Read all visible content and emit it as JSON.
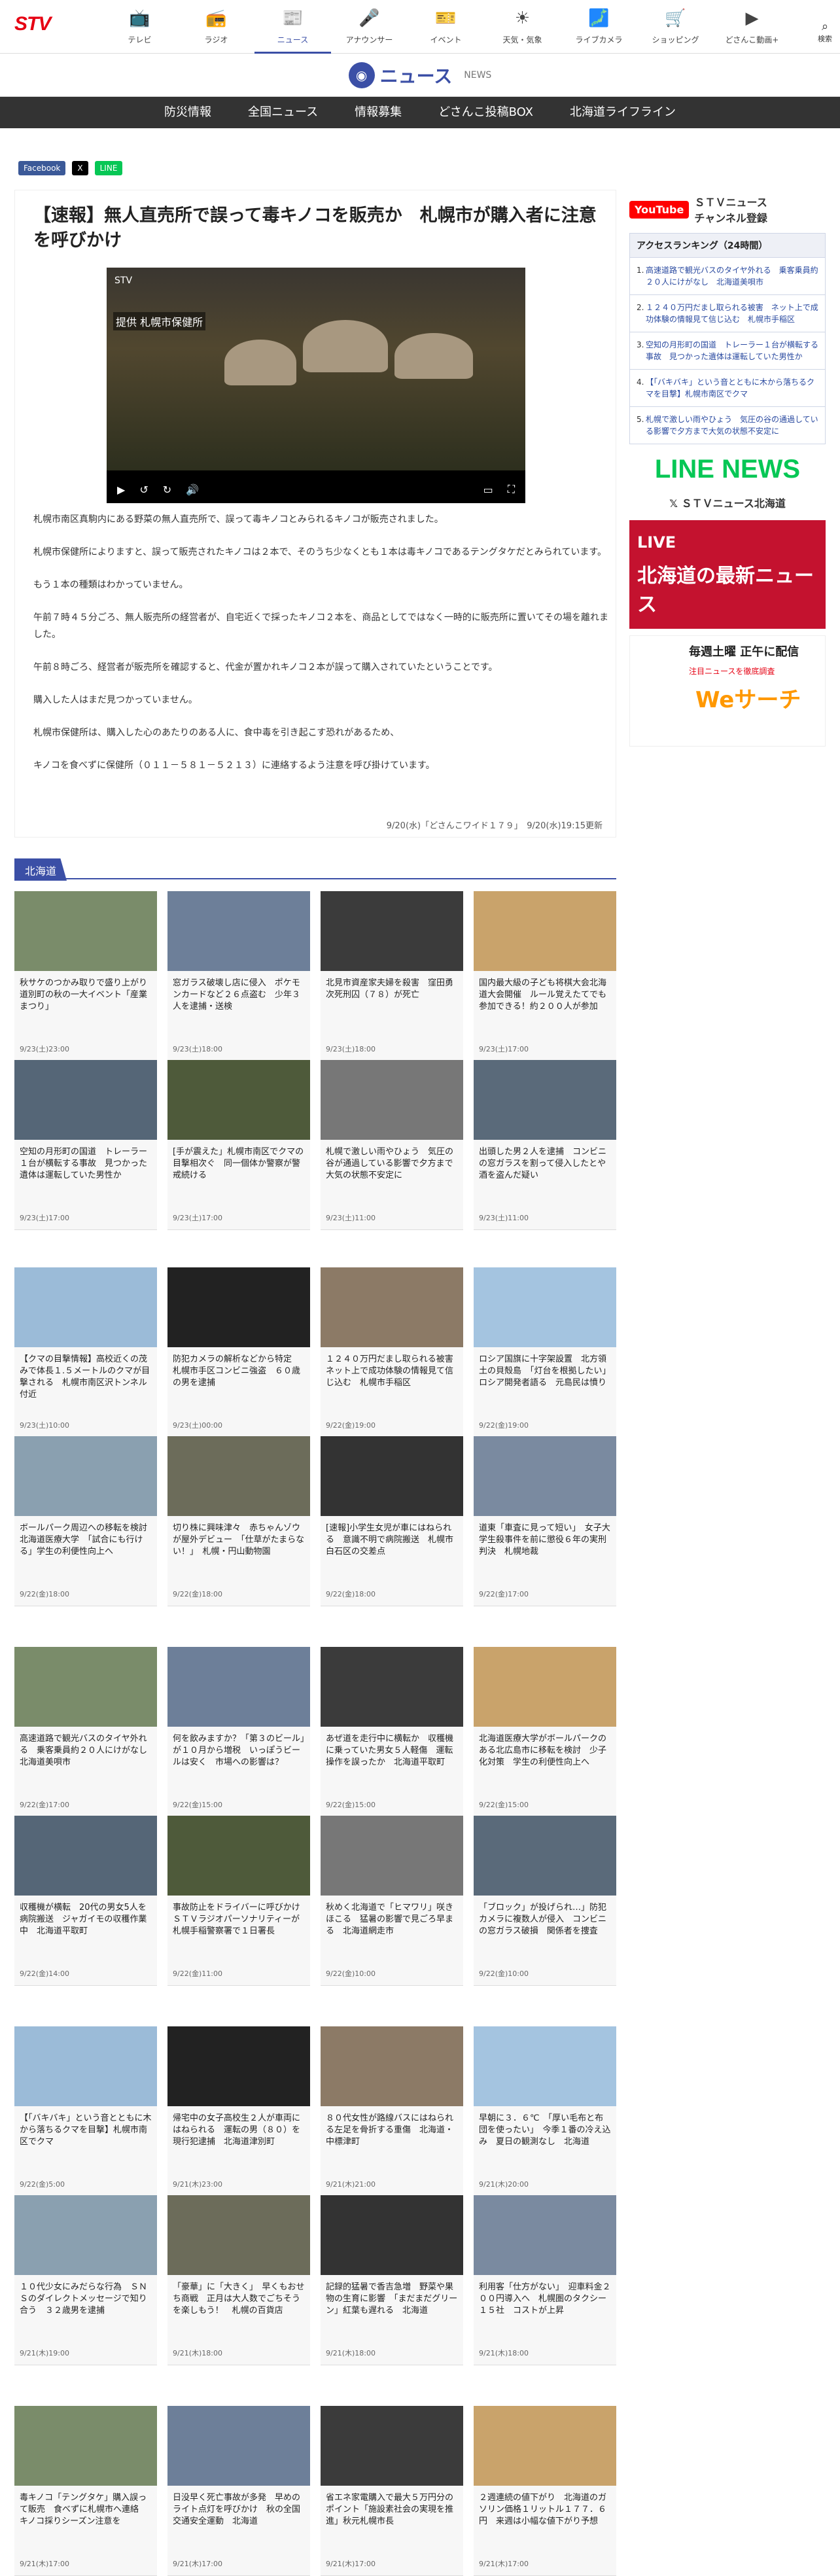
{
  "brand": "STV",
  "topnav": [
    {
      "label": "テレビ",
      "icon": "tv-icon",
      "glyph": "📺"
    },
    {
      "label": "ラジオ",
      "icon": "radio-icon",
      "glyph": "📻"
    },
    {
      "label": "ニュース",
      "icon": "news-icon",
      "glyph": "📰"
    },
    {
      "label": "アナウンサー",
      "icon": "microphone-icon",
      "glyph": "🎤"
    },
    {
      "label": "イベント",
      "icon": "ticket-icon",
      "glyph": "🎫"
    },
    {
      "label": "天気・気象",
      "icon": "sun-icon",
      "glyph": "☀"
    },
    {
      "label": "ライブカメラ",
      "icon": "map-icon",
      "glyph": "🗾"
    },
    {
      "label": "ショッピング",
      "icon": "cart-icon",
      "glyph": "🛒"
    },
    {
      "label": "どさんこ動画+",
      "icon": "dosanko-icon",
      "glyph": "▶"
    }
  ],
  "search_label": "検索",
  "newsbar": {
    "title": "ニュース",
    "sub": "NEWS"
  },
  "subnav": [
    "防災情報",
    "全国ニュース",
    "情報募集",
    "どさんこ投稿BOX",
    "北海道ライフライン"
  ],
  "share": {
    "facebook": "Facebook",
    "x": "X",
    "line": "LINE"
  },
  "article": {
    "title": "【速報】無人直売所で誤って毒キノコを販売か　札幌市が購入者に注意を呼びかけ",
    "video_badge": "STV",
    "video_caption": "提供 札幌市保健所",
    "paragraphs": [
      "札幌市南区真駒内にある野菜の無人直売所で、誤って毒キノコとみられるキノコが販売されました。",
      "札幌市保健所によりますと、誤って販売されたキノコは２本で、そのうち少なくとも１本は毒キノコであるテングタケだとみられています。",
      "もう１本の種類はわかっていません。",
      "午前７時４５分ごろ、無人販売所の経営者が、自宅近くで採ったキノコ２本を、商品としてではなく一時的に販売所に置いてその場を離れました。",
      "午前８時ごろ、経営者が販売所を確認すると、代金が置かれキノコ２本が誤って購入されていたということです。",
      "購入した人はまだ見つかっていません。",
      "札幌市保健所は、購入した心のあたりのある人に、食中毒を引き起こす恐れがあるため、",
      "キノコを食べずに保健所（０１１－５８１－５２１３）に連絡するよう注意を呼び掛けています。"
    ],
    "date": "9/20(水)「どさんこワイド１７９」　9/20(水)19:15更新"
  },
  "sidebar": {
    "youtube": "YouTube",
    "yt_text": "ＳＴＶニュース\nチャンネル登録",
    "ranking_title": "アクセスランキング（24時間）",
    "ranking": [
      "高速道路で観光バスのタイヤ外れる　乗客乗員約２０人にけがなし　北海道美唄市",
      "１２４０万円だまし取られる被害　ネット上で成功体験の情報見て信じ込む　札幌市手稲区",
      "空知の月形町の国道　トレーラー１台が横転する事故　見つかった遺体は運転していた男性か",
      "【「バキバキ」という音とともに木から落ちるクマを目撃】札幌市南区でクマ",
      "札幌で激しい雨やひょう　気圧の谷の通過している影響で夕方まで大気の状態不安定に"
    ],
    "linenews": "LINE NEWS",
    "x_account": "ＳＴＶニュース北海道",
    "banner1_a": "LIVE",
    "banner1_b": "北海道の最新ニュース",
    "banner2_a": "毎週土曜 正午に配信",
    "banner2_b": "注目ニュースを徹底調査",
    "banner2_c": "Weサーチ"
  },
  "section_title": "北海道",
  "cards": [
    [
      "秋サケのつかみ取りで盛り上がり　道別町の秋の一大イベント「産業まつり」",
      "9/23(土)23:00"
    ],
    [
      "窓ガラス破壊し店に侵入　ポケモンカードなど２６点盗む　少年３人を逮捕・送検",
      "9/23(土)18:00"
    ],
    [
      "北見市資産家夫婦を殺害　窪田勇次死刑囚（７８）が死亡",
      "9/23(土)18:00"
    ],
    [
      "国内最大級の子ども将棋大会北海道大会開催　ルール覚えたてでも参加できる！約２００人が参加",
      "9/23(土)17:00"
    ],
    [
      "空知の月形町の国道　トレーラー１台が横転する事故　見つかった遺体は運転していた男性か",
      "9/23(土)17:00"
    ],
    [
      "[手が震えた」札幌市南区でクマの目撃相次ぐ　同一個体か警察が警戒続ける",
      "9/23(土)17:00"
    ],
    [
      "札幌で激しい雨やひょう　気圧の谷が通過している影響で夕方まで大気の状態不安定に",
      "9/23(土)11:00"
    ],
    [
      "出頭した男２人を逮捕　コンビニの窓ガラスを割って侵入したとや酒を盗んだ疑い",
      "9/23(土)11:00"
    ],
    [
      "【クマの目撃情報】高校近くの茂みで体長１.５メートルのクマが目撃される　札幌市南区沢トンネル付近",
      "9/23(土)10:00"
    ],
    [
      "防犯カメラの解析などから特定　札幌市手区コンビニ強盗　６０歳の男を逮捕",
      "9/23(土)00:00"
    ],
    [
      "１２４０万円だまし取られる被害　ネット上で成功体験の情報見て信じ込む　札幌市手稲区",
      "9/22(金)19:00"
    ],
    [
      "ロシア国旗に十字架設置　北方領土の貝殻島　「灯台を根拠したい」ロシア開発者語る　元島民は憤り",
      "9/22(金)19:00"
    ],
    [
      "ボールパーク周辺への移転を検討　北海道医療大学　「試合にも行ける」学生の利便性向上へ",
      "9/22(金)18:00"
    ],
    [
      "切り株に興味津々　赤ちゃんゾウが屋外デビュー　「仕草がたまらない！」　札幌・円山動物園",
      "9/22(金)18:00"
    ],
    [
      "[速報]小学生女児が車にはねられる　意識不明で病院搬送　札幌市白石区の交差点",
      "9/22(金)18:00"
    ],
    [
      "道東「車査に見って短い」　女子大学生殺事件を前に懲役６年の実刑判決　札幌地裁",
      "9/22(金)17:00"
    ],
    [
      "高速道路で観光バスのタイヤ外れる　乗客乗員約２０人にけがなし　北海道美唄市",
      "9/22(金)17:00"
    ],
    [
      "何を飲みますか？「第３のビール」が１０月から増税　いっぽうビールは安く　市場への影響は？",
      "9/22(金)15:00"
    ],
    [
      "あぜ道を走行中に横転か　収穫機に乗っていた男女５人軽傷　運転操作を誤ったか　北海道平取町",
      "9/22(金)15:00"
    ],
    [
      "北海道医療大学がボールパークのある北広島市に移転を検討　少子化対策　学生の利便性向上へ",
      "9/22(金)15:00"
    ],
    [
      "収穫機が横転　20代の男女5人を病院搬送　ジャガイモの収穫作業中　北海道平取町",
      "9/22(金)14:00"
    ],
    [
      "事故防止をドライバーに呼びかけ　ＳＴＶラジオパーソナリティーが札幌手稲警察署で１日署長",
      "9/22(金)11:00"
    ],
    [
      "秋めく北海道で「ヒマワリ」咲きほこる　猛暑の影響で見ごろ早まる　北海道網走市",
      "9/22(金)10:00"
    ],
    [
      "「ブロック」が投げられ…」防犯カメラに複数人が侵入　コンビニの窓ガラス破損　関係者を捜査",
      "9/22(金)10:00"
    ],
    [
      "【「バキバキ」という音とともに木から落ちるクマを目撃】札幌市南区でクマ",
      "9/22(金)5:00"
    ],
    [
      "帰宅中の女子高校生２人が車両にはねられる　運転の男（８０）を現行犯逮捕　北海道津別町",
      "9/21(木)23:00"
    ],
    [
      "８０代女性が路線バスにはねられる左足を骨折する重傷　北海道・中標津町",
      "9/21(木)21:00"
    ],
    [
      "早朝に３．６℃　「厚い毛布と布団を使ったい」　今季１番の冷え込み　夏日の観測なし　北海道",
      "9/21(木)20:00"
    ],
    [
      "１０代少女にみだらな行為　ＳＮＳのダイレクトメッセージで知り合う　３２歳男を逮捕",
      "9/21(木)19:00"
    ],
    [
      "「豪華」に「大きく」　早くもおせち商戦　正月は大人数でごちそうを楽しもう！　札幌の百貨店",
      "9/21(木)18:00"
    ],
    [
      "記録的猛暑で香吉急増　野菜や果物の生育に影響　「まだまだグリーン」紅葉も遅れる　北海道",
      "9/21(木)18:00"
    ],
    [
      "利用客「仕方がない」　迎車料金２００円導入へ　札幌圏のタクシー１５社　コストが上昇",
      "9/21(木)18:00"
    ],
    [
      "毒キノコ「テングタケ」購入誤って販売　食べずに札幌市へ連絡　キノコ採りシーズン注意を",
      "9/21(木)17:00"
    ],
    [
      "日没早く死亡事故が多発　早めのライト点灯を呼びかけ　秋の全国交通安全運動　北海道",
      "9/21(木)17:00"
    ],
    [
      "省エネ家電購入で最大５万円分のポイント「施設素社会の実現を推進」秋元札幌市長",
      "9/21(木)17:00"
    ],
    [
      "２週連続の値下がり　北海道のガソリン価格１リットル１７７．６円　来週は小幅な値下がり予想",
      "9/21(木)17:00"
    ]
  ],
  "colors": {
    "brand_blue": "#3b4fa6",
    "stv_red": "#e60012",
    "line_green": "#06c755"
  }
}
